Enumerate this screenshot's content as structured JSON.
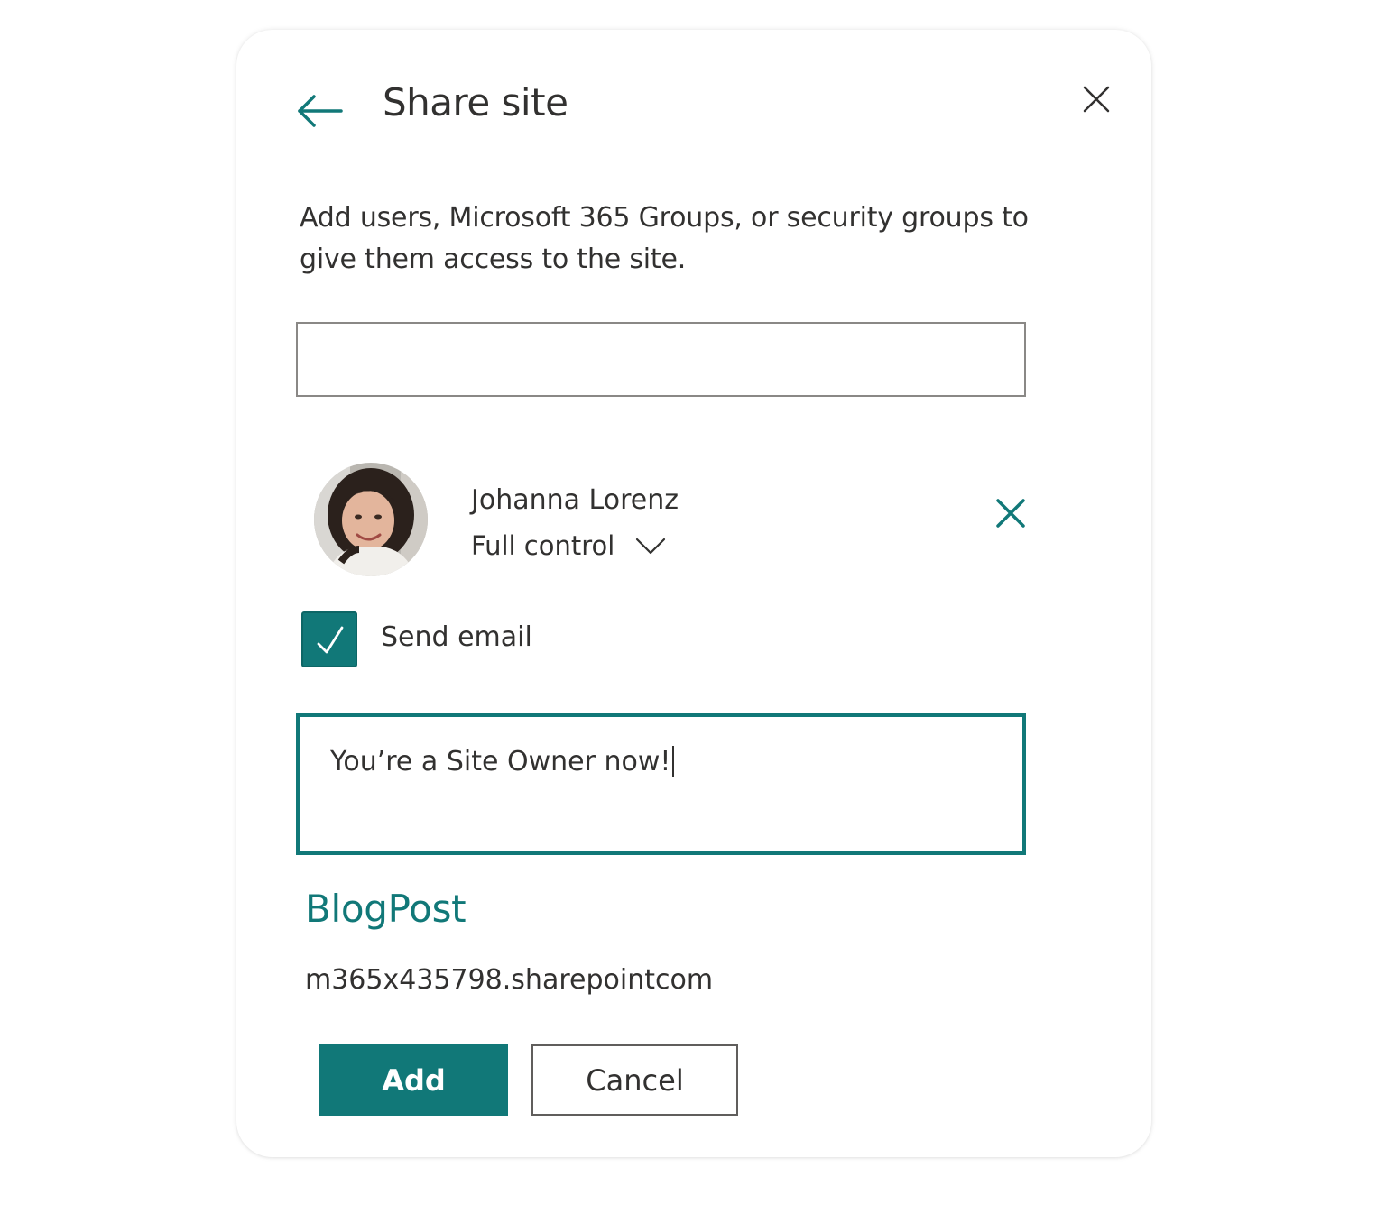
{
  "panel": {
    "title": "Share site",
    "back_icon": "arrow-left-icon",
    "close_icon": "close-icon",
    "description": "Add users, Microsoft 365 Groups, or security groups to give them access to the site."
  },
  "search": {
    "value": "",
    "placeholder": ""
  },
  "user": {
    "name": "Johanna Lorenz",
    "permission": "Full control",
    "remove_icon": "close-icon"
  },
  "send_email": {
    "label": "Send email",
    "checked": true
  },
  "message": {
    "value": "You’re a Site Owner now!"
  },
  "site": {
    "name": "BlogPost",
    "url": "m365x435798.sharepointcom"
  },
  "actions": {
    "add_label": "Add",
    "cancel_label": "Cancel"
  },
  "colors": {
    "accent": "#117878",
    "text": "#323130",
    "border": "#8a8886"
  }
}
